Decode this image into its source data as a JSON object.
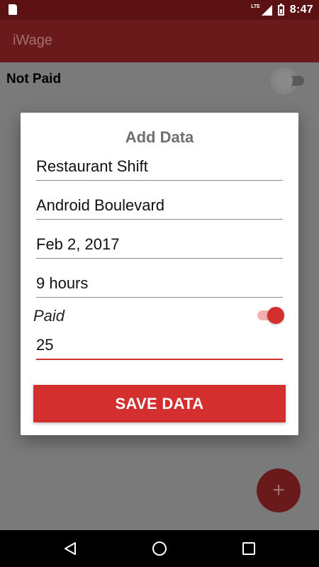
{
  "status_bar": {
    "network": "LTE",
    "time": "8:47",
    "icons": [
      "sd-card-icon",
      "signal-icon",
      "battery-icon"
    ]
  },
  "app_bar": {
    "title": "iWage"
  },
  "main": {
    "filter_label": "Not Paid",
    "filter_switch_on": false,
    "fab_icon": "+"
  },
  "dialog": {
    "title": "Add Data",
    "fields": {
      "job_name": "Restaurant Shift",
      "location": "Android Boulevard",
      "date": "Feb 2, 2017",
      "duration": "9 hours",
      "amount": "25"
    },
    "paid_label": "Paid",
    "paid_switch_on": true,
    "save_label": "SAVE DATA"
  },
  "nav_bar": {
    "icons": [
      "back-icon",
      "home-icon",
      "recents-icon"
    ]
  },
  "colors": {
    "status_bar": "#5c1212",
    "app_bar": "#6a1a1a",
    "accent": "#d32f2f",
    "scrim_bg": "#7a7a7a"
  }
}
